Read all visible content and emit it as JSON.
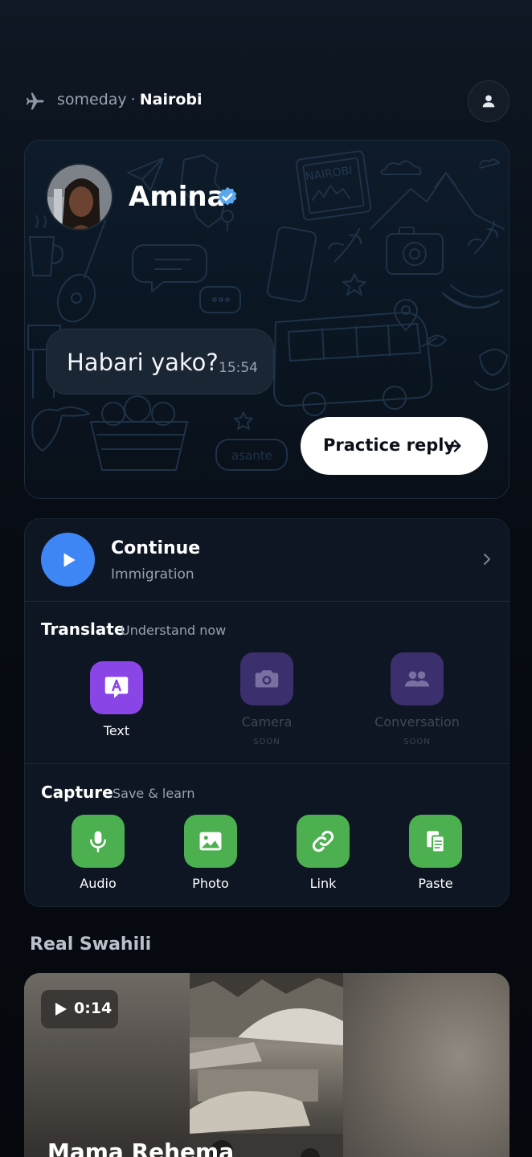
{
  "header": {
    "plane_icon": "airplane-icon",
    "prefix": "someday",
    "separator": "·",
    "city": "Nairobi",
    "profile_icon": "user-icon"
  },
  "hero": {
    "name": "Amina",
    "verified_icon": "verified-check-icon",
    "message": "Habari yako?",
    "time": "15:54",
    "practice_label": "Practice reply",
    "stamp_text": "NAIROBI",
    "faded_word": "asante"
  },
  "continue": {
    "title": "Continue",
    "subtitle": "Immigration"
  },
  "translate": {
    "title": "Translate",
    "subtitle": "Understand now",
    "items": [
      {
        "label": "Text",
        "badge": "",
        "icon": "translate-text-icon"
      },
      {
        "label": "Camera",
        "badge": "SOON",
        "icon": "camera-icon"
      },
      {
        "label": "Conversation",
        "badge": "SOON",
        "icon": "people-icon"
      }
    ]
  },
  "capture": {
    "title": "Capture",
    "subtitle": "Save & learn",
    "items": [
      {
        "label": "Audio",
        "icon": "microphone-icon"
      },
      {
        "label": "Photo",
        "icon": "image-icon"
      },
      {
        "label": "Link",
        "icon": "link-icon"
      },
      {
        "label": "Paste",
        "icon": "paste-icon"
      }
    ]
  },
  "real_swahili": {
    "title": "Real Swahili",
    "video": {
      "duration": "0:14",
      "title": "Mama Rehema"
    }
  },
  "colors": {
    "accent_blue": "#3e86f5",
    "purple_active": "#8a45e6",
    "purple_disabled": "#3b2f6e",
    "green": "#4cb050"
  }
}
